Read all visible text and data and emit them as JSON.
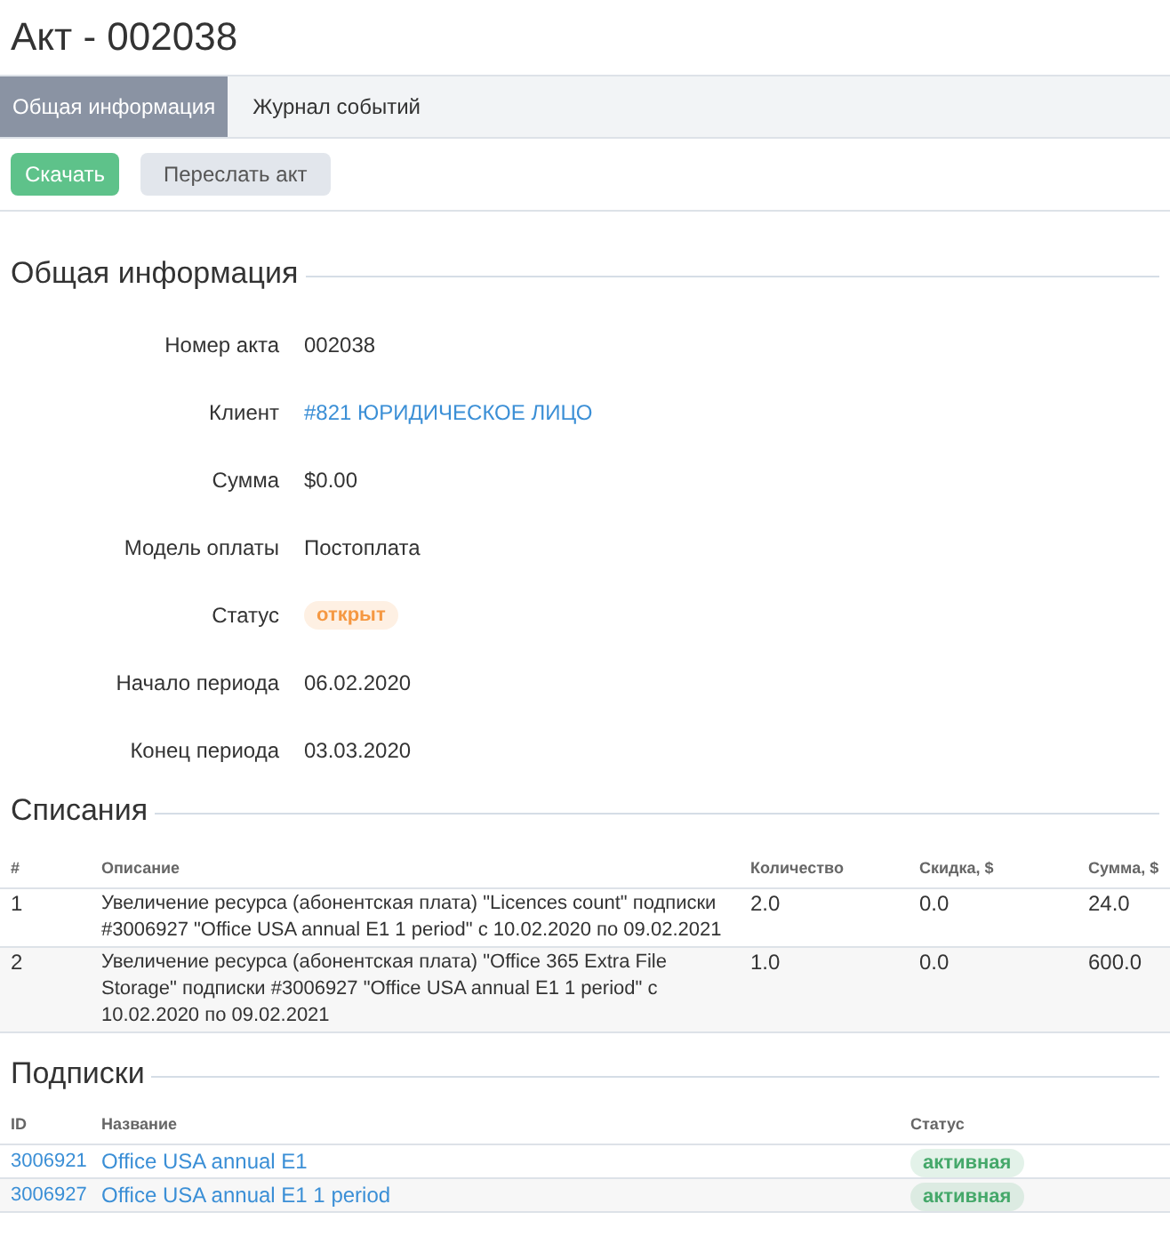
{
  "title": "Акт - 002038",
  "tabs": [
    {
      "label": "Общая информация",
      "selected": true
    },
    {
      "label": "Журнал событий",
      "selected": false
    }
  ],
  "toolbar": [
    {
      "label": "Скачать",
      "kind": "primary"
    },
    {
      "label": "Переслать акт",
      "kind": "secondary"
    }
  ],
  "general": {
    "heading": "Общая информация",
    "fields": [
      {
        "label": "Номер акта",
        "value": "002038",
        "kind": "text"
      },
      {
        "label": "Клиент",
        "value": "#821 ЮРИДИЧЕСКОЕ ЛИЦО",
        "kind": "link"
      },
      {
        "label": "Сумма",
        "value": "$0.00",
        "kind": "text"
      },
      {
        "label": "Модель оплаты",
        "value": "Постоплата",
        "kind": "text"
      },
      {
        "label": "Статус",
        "value": "открыт",
        "kind": "badge",
        "color": "#f59842"
      },
      {
        "label": "Начало периода",
        "value": "06.02.2020",
        "kind": "text"
      },
      {
        "label": "Конец периода",
        "value": "03.03.2020",
        "kind": "text"
      }
    ]
  },
  "charges": {
    "heading": "Списания",
    "columns": [
      "#",
      "Описание",
      "Количество",
      "Скидка, $",
      "Сумма, $"
    ],
    "rows": [
      [
        "1",
        "Увеличение ресурса (абонентская плата) \"Licences count\" подписки #3006927 \"Office USA annual E1 1 period\" с 10.02.2020 по 09.02.2021",
        "2.0",
        "0.0",
        "24.0"
      ],
      [
        "2",
        "Увеличение ресурса (абонентская плата) \"Office 365 Extra File Storage\" подписки #3006927 \"Office USA annual E1 1 period\" с 10.02.2020 по 09.02.2021",
        "1.0",
        "0.0",
        "600.0"
      ]
    ]
  },
  "subscriptions": {
    "heading": "Подписки",
    "columns": [
      "ID",
      "Название",
      "Статус"
    ],
    "rows": [
      {
        "id": "3006921",
        "name": "Office USA annual E1",
        "status": "активная",
        "color": "#45a86a"
      },
      {
        "id": "3006927",
        "name": "Office USA annual E1 1 period",
        "status": "активная",
        "color": "#45a86a"
      }
    ]
  }
}
